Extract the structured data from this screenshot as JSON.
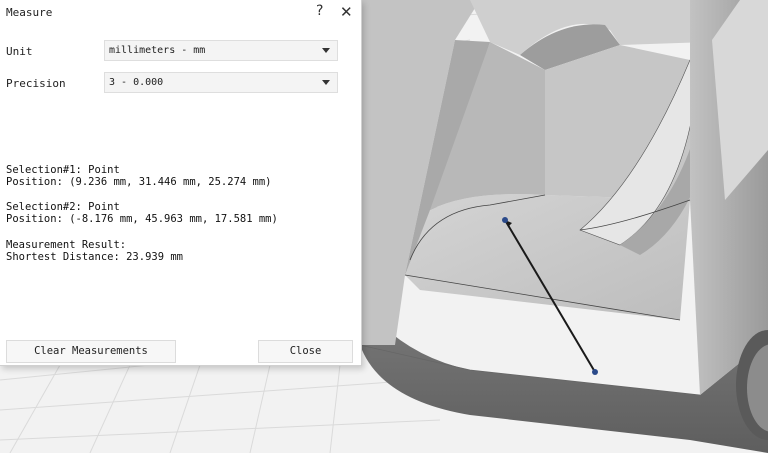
{
  "dialog": {
    "title": "Measure",
    "help_label": "?",
    "close_label": "✕",
    "unit_label": "Unit",
    "unit_value": "millimeters - mm",
    "precision_label": "Precision",
    "precision_value": "3 - 0.000",
    "sel1_title": "Selection#1: Point",
    "sel1_position": "Position: (9.236 mm, 31.446 mm, 25.274 mm)",
    "sel2_title": "Selection#2: Point",
    "sel2_position": "Position: (-8.176 mm, 45.963 mm, 17.581 mm)",
    "result_title": "Measurement Result:",
    "result_value": "Shortest Distance: 23.939 mm",
    "clear_button": "Clear Measurements",
    "close_button": "Close"
  },
  "colors": {
    "model_face": "#c8c8c8",
    "model_dark": "#6e6e6e",
    "grid": "#d8d8d8",
    "measure_line": "#1a1a1a",
    "point": "#2b4a8a"
  }
}
